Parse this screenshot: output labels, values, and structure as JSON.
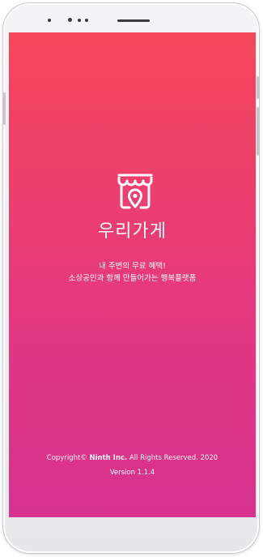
{
  "app": {
    "name": "우리가게",
    "tagline_line1": "내 주변의 무료 혜택!",
    "tagline_line2": "소상공인과 함께 만들어가는 행복플랫폼"
  },
  "footer": {
    "copyright_prefix": "Copyright© ",
    "company": "Ninth Inc.",
    "copyright_suffix": " All Rights Reserved. 2020",
    "version": "Version 1.1.4"
  },
  "colors": {
    "gradient_top": "#f5475a",
    "gradient_bottom": "#d6338f",
    "text": "#ffffff"
  },
  "icons": {
    "logo": "storefront-location-pin-icon"
  }
}
